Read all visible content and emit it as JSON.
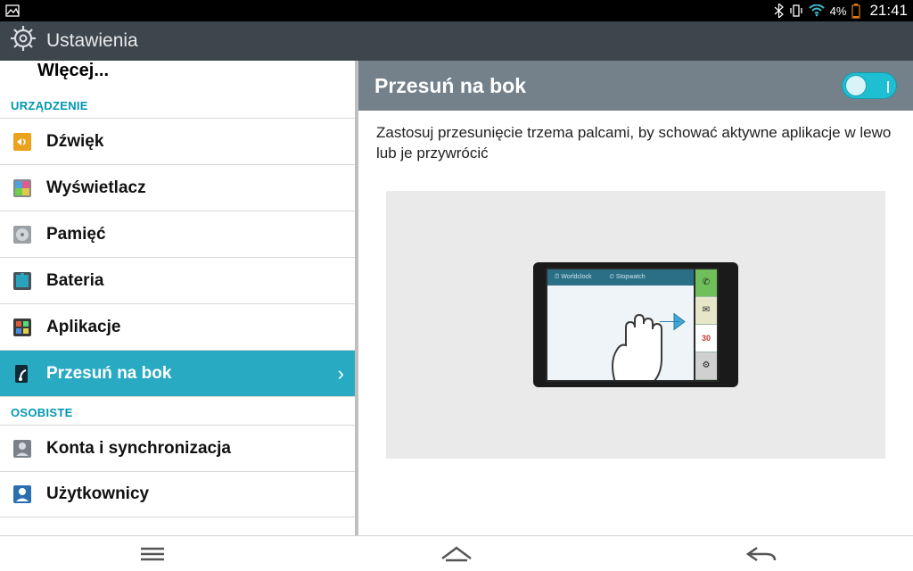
{
  "status_bar": {
    "battery_pct": "4%",
    "time": "21:41"
  },
  "app_bar": {
    "title": "Ustawienia"
  },
  "sidebar": {
    "truncated_top": "WIęcej...",
    "section_device": "URZĄDZENIE",
    "items": [
      {
        "label": "Dźwięk"
      },
      {
        "label": "Wyświetlacz"
      },
      {
        "label": "Pamięć"
      },
      {
        "label": "Bateria"
      },
      {
        "label": "Aplikacje"
      },
      {
        "label": "Przesuń na bok"
      }
    ],
    "section_personal": "OSOBISTE",
    "personal_items": [
      {
        "label": "Konta i synchronizacja"
      },
      {
        "label": "Użytkownicy"
      }
    ]
  },
  "content": {
    "title": "Przesuń na bok",
    "toggle_state": "on",
    "description": "Zastosuj przesunięcie trzema palcami, by schować aktywne aplikacje w lewo lub je przywrócić"
  },
  "illustration": {
    "tab1": "Worldclock",
    "tab2": "Stopwatch",
    "calendar_day": "30"
  }
}
